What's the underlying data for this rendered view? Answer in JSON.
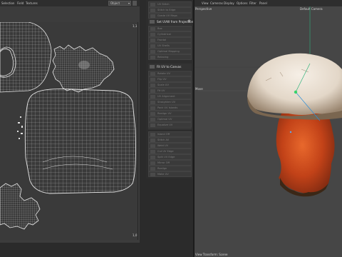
{
  "uv_editor": {
    "menu": [
      "Selection",
      "Field",
      "Textures"
    ],
    "object_selector": "Object",
    "corner_label": "1,1",
    "corner_label_bottom": "1,0"
  },
  "tool_panel": {
    "top_items": [
      "UV Stitch",
      "Stitch to Edge",
      "Grade UV Maps"
    ],
    "header1": "Set UVW from Projection",
    "group1": [
      "Box",
      "Cylindrical",
      "Frontal",
      "UV Shells",
      "Optimal Mapping",
      "Relaxing"
    ],
    "header2": "Fit UV to Canvas",
    "group2": [
      "Rotate UV",
      "Flip UV",
      "Scale UV",
      "Fit UV",
      "UV Alignment",
      "Straighten UV",
      "Pack UV Islands",
      "Realign UV",
      "Optimal UV",
      "Equalize UV"
    ],
    "group3": [
      "Island Off",
      "Stitch All",
      "Weld UV",
      "Cut UV Edge",
      "Split UV Edge",
      "Mirror Off",
      "Realign",
      "Make UV"
    ]
  },
  "viewport": {
    "menu": [
      "View",
      "Cameras",
      "Display",
      "Options",
      "Filter",
      "Panel"
    ],
    "perspective_label": "Perspective",
    "camera_label": "Default Camera",
    "axis_label": "Move",
    "status_label": "View Transform: Scene"
  },
  "colors": {
    "uv_background": "#3a3a3a",
    "uv_lines": "#d8d8d8",
    "viewport_background": "#464646",
    "mushroom_cap": "#e7ddd2",
    "mushroom_stem": "#c44a1e"
  }
}
